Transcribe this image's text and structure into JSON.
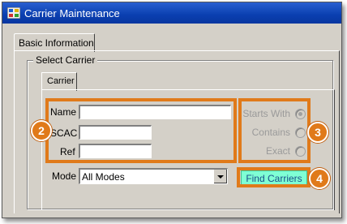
{
  "window": {
    "title": "Carrier Maintenance"
  },
  "tabs": {
    "basic_information": "Basic Information"
  },
  "select_carrier": {
    "group_label": "Select Carrier",
    "inner_tab": "Carrier",
    "fields": {
      "name_label": "Name",
      "scac_label": "SCAC",
      "ref_label": "Ref",
      "name_value": "",
      "scac_value": "",
      "ref_value": ""
    },
    "search_mode": {
      "options": [
        "Starts With",
        "Contains",
        "Exact"
      ],
      "selected": "Starts With"
    },
    "mode": {
      "label": "Mode",
      "selected": "All Modes"
    },
    "find_button": "Find Carriers"
  },
  "callouts": [
    "2",
    "3",
    "4"
  ],
  "colors": {
    "callout": "#e07a1a",
    "find_button_bg": "#7fffd4",
    "titlebar": "#0a3fb0"
  }
}
